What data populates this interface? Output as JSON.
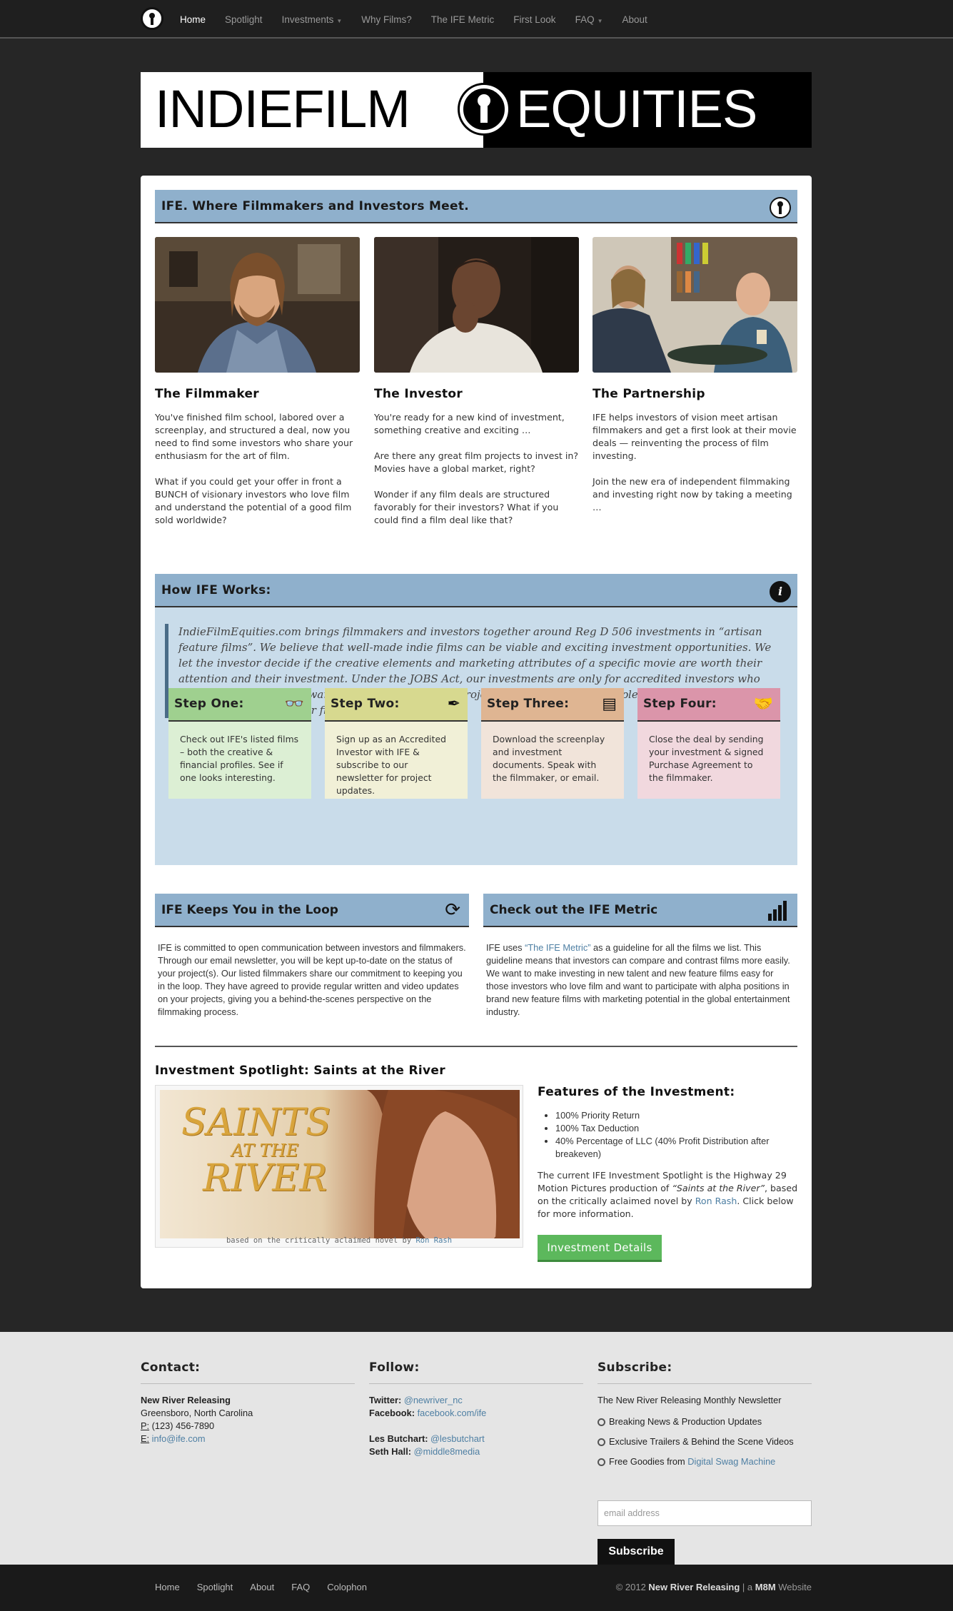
{
  "nav": {
    "items": [
      {
        "label": "Home",
        "active": true
      },
      {
        "label": "Spotlight"
      },
      {
        "label": "Investments",
        "dropdown": true
      },
      {
        "label": "Why Films?"
      },
      {
        "label": "The IFE Metric"
      },
      {
        "label": "First Look"
      },
      {
        "label": "FAQ",
        "dropdown": true
      },
      {
        "label": "About"
      }
    ]
  },
  "banner": {
    "left": "INDIEFILM",
    "right": "EQUITIES"
  },
  "intro": {
    "title": "IFE. Where Filmmakers and Investors Meet.",
    "columns": [
      {
        "title": "The Filmmaker",
        "p1": "You've finished film school, labored over a screenplay, and structured a deal, now you need to find some investors who share your enthusiasm for the art of film.",
        "p2": "What if you could get your offer in front a BUNCH of visionary investors who love film and understand the potential of a good film sold worldwide?",
        "p3": ""
      },
      {
        "title": "The Investor",
        "p1": "You're ready for a new kind of investment, something creative and exciting …",
        "p2": "Are there any great film projects to invest in? Movies have a global market, right?",
        "p3": "Wonder if any film deals are structured favorably for their investors? What if you could find a film deal like that?"
      },
      {
        "title": "The Partnership",
        "p1": "IFE helps investors of vision meet artisan filmmakers and get a first look at their movie deals — reinventing the process of film investing.",
        "p2": "Join the new era of independent filmmaking and investing right now by taking a meeting …",
        "p3": ""
      }
    ]
  },
  "works": {
    "title": "How IFE Works:",
    "quote": "IndieFilmEquities.com brings filmmakers and investors together around Reg D 506 investments in “artisan feature films”. We believe that well-made indie films can be viable and exciting investment opportunities. We let the investor decide if the creative elements and marketing attributes of a specific movie are worth their attention and their investment. Under the JOBS Act, our investments are only for accredited investors who can embrace the risk-reward profile of a given film project. IFE provides four simple steps that put new movie investments right at your fingertips.",
    "steps": [
      {
        "title": "Step One:",
        "icon": "glasses-icon",
        "glyph": "👓",
        "body": "Check out IFE's listed films – both the creative & financial profiles. See if one looks interesting.",
        "head_color": "#9fd08f",
        "body_color": "#dcefd4"
      },
      {
        "title": "Step Two:",
        "icon": "pen-icon",
        "glyph": "✒",
        "body": "Sign up as an Accredited Investor with IFE & subscribe to our newsletter for project updates.",
        "head_color": "#d7d98f",
        "body_color": "#f1f0d7"
      },
      {
        "title": "Step Three:",
        "icon": "document-icon",
        "glyph": "▤",
        "body": "Download the screenplay and investment documents. Speak with the filmmaker, or email.",
        "head_color": "#dfb592",
        "body_color": "#f1e4da"
      },
      {
        "title": "Step Four:",
        "icon": "handshake-icon",
        "glyph": "🤝",
        "body": "Close the deal by sending your investment & signed Purchase Agreement to the filmmaker.",
        "head_color": "#db95aa",
        "body_color": "#f1d8de"
      }
    ]
  },
  "loop": {
    "title": "IFE Keeps You in the Loop",
    "body": "IFE is committed to open communication between investors and filmmakers. Through our email newsletter, you will be kept up-to-date on the status of your project(s). Our listed filmmakers share our commitment to keeping you in the loop. They have agreed to provide regular written and video updates on your projects, giving you a behind-the-scenes perspective on the filmmaking process."
  },
  "metric": {
    "title": "Check out the IFE Metric",
    "pre": "IFE uses ",
    "link": "“The IFE Metric”",
    "post": " as a guideline for all the films we list. This guideline means that investors can compare and contrast films more easily. We want to make investing in new talent and new feature films easy for those investors who love film and want to participate with alpha positions in brand new feature films with marketing potential in the global entertainment industry."
  },
  "spotlight": {
    "title": "Investment Spotlight: Saints at the River",
    "poster_line1": "SAINTS",
    "poster_line2": "AT THE",
    "poster_line3": "RIVER",
    "caption_pre": "based on the critically aclaimed novel by ",
    "caption_link": "Ron Rash",
    "features_title": "Features of the Investment:",
    "features": [
      "100% Priority Return",
      "100% Tax Deduction",
      "40% Percentage of LLC (40% Profit Distribution after breakeven)"
    ],
    "desc_pre": "The current IFE Investment Spotlight is the Highway 29 Motion Pictures production of ",
    "desc_em": "“Saints at the River”",
    "desc_mid": ", based on the critically aclaimed novel by ",
    "desc_link": "Ron Rash",
    "desc_post": ". Click below for more information.",
    "button": "Investment Details"
  },
  "footer": {
    "contact": {
      "title": "Contact:",
      "name": "New River Releasing",
      "city": "Greensboro, North Carolina",
      "phone_label": "P:",
      "phone": "(123) 456-7890",
      "email_label": "E:",
      "email": "info@ife.com"
    },
    "follow": {
      "title": "Follow:",
      "twitter_label": "Twitter:",
      "twitter": "@newriver_nc",
      "facebook_label": "Facebook:",
      "facebook": "facebook.com/ife",
      "p1_label": "Les Butchart:",
      "p1": "@lesbutchart",
      "p2_label": "Seth Hall:",
      "p2": "@middle8media"
    },
    "subscribe": {
      "title": "Subscribe:",
      "desc": "The New River Releasing Monthly Newsletter",
      "items": [
        "Breaking News & Production Updates",
        "Exclusive Trailers & Behind the Scene Videos"
      ],
      "item3_pre": "Free Goodies from ",
      "item3_link": "Digital Swag Machine",
      "placeholder": "email address",
      "button": "Subscribe"
    }
  },
  "bottom": {
    "links": [
      "Home",
      "Spotlight",
      "About",
      "FAQ",
      "Colophon"
    ],
    "copy_pre": "© 2012 ",
    "copy_name": "New River Releasing",
    "copy_mid": " | a ",
    "copy_brand": "M8M",
    "copy_post": " Website"
  }
}
